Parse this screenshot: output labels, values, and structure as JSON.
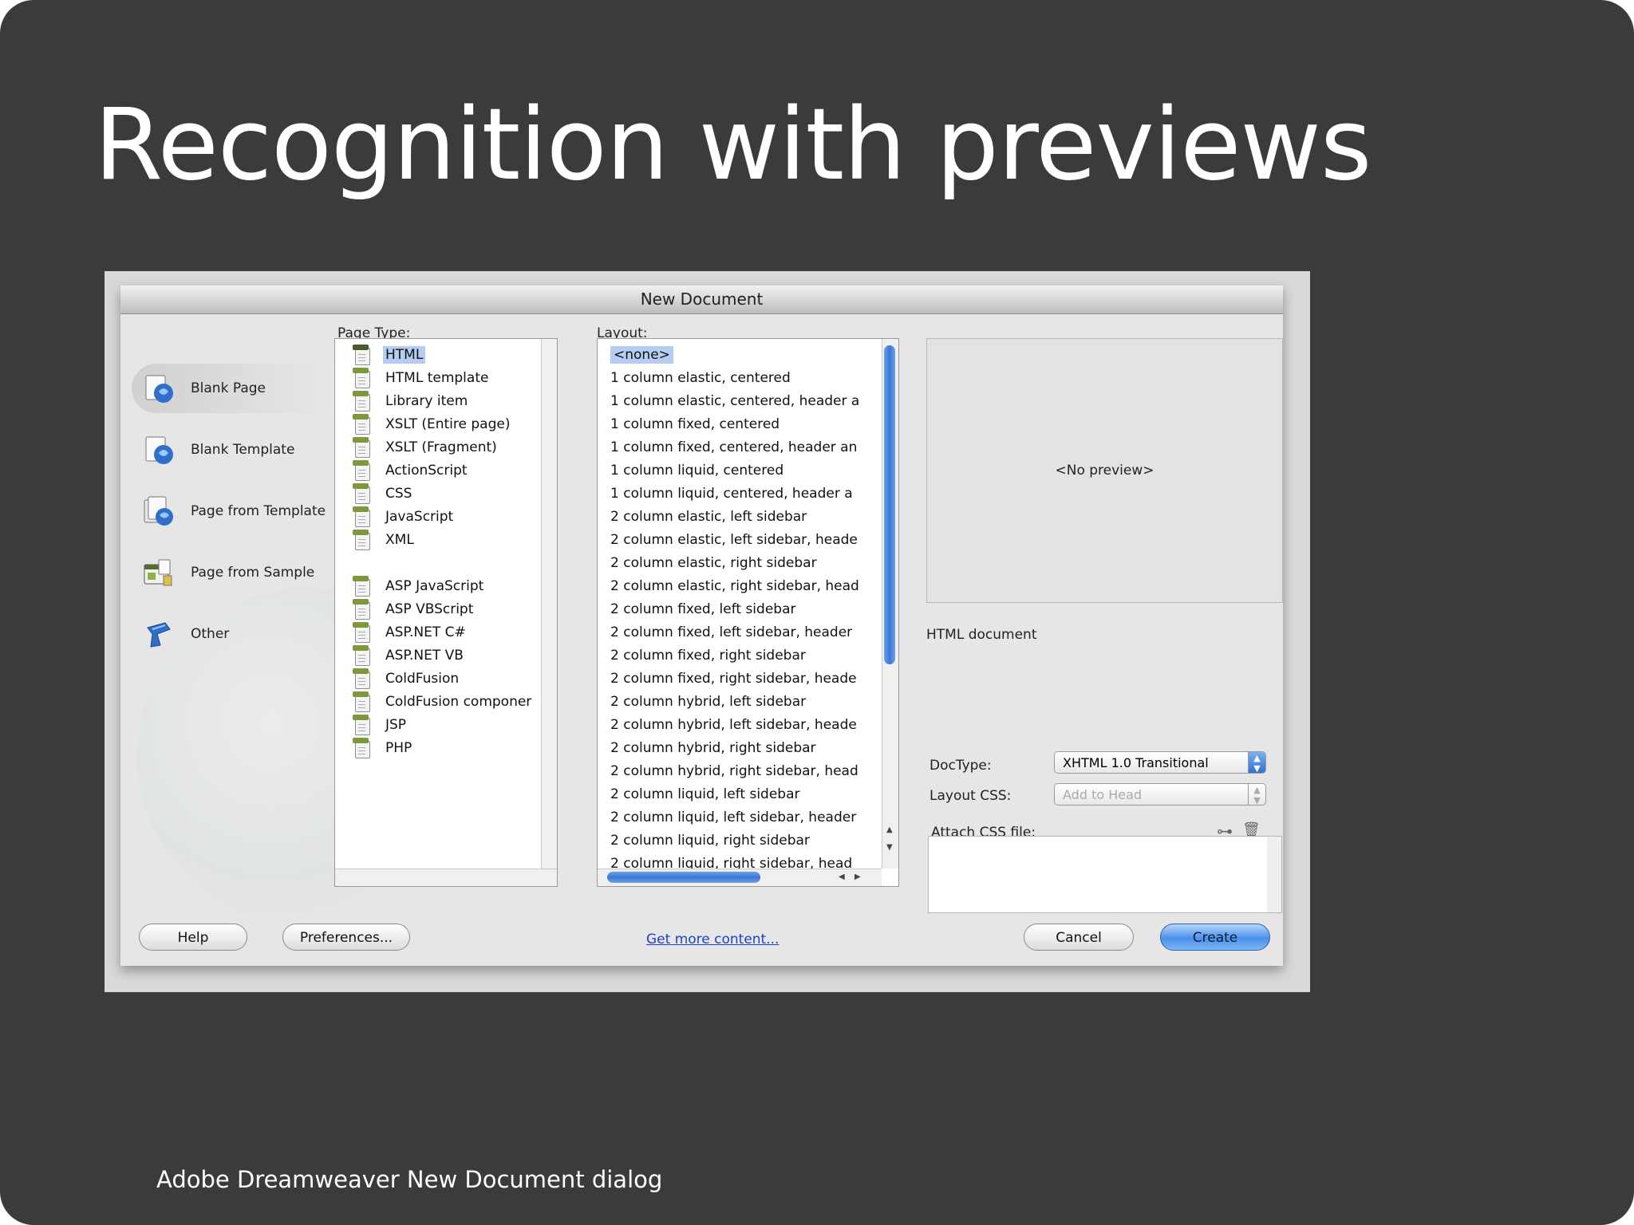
{
  "slide": {
    "title": "Recognition with previews",
    "caption": "Adobe Dreamweaver New Document dialog"
  },
  "dialog": {
    "title": "New Document",
    "categories": [
      {
        "label": "Blank Page",
        "icon": "blank-page-icon",
        "selected": true
      },
      {
        "label": "Blank Template",
        "icon": "blank-template-icon"
      },
      {
        "label": "Page from Template",
        "icon": "page-from-template-icon"
      },
      {
        "label": "Page from Sample",
        "icon": "page-from-sample-icon"
      },
      {
        "label": "Other",
        "icon": "other-icon"
      }
    ],
    "page_type": {
      "label": "Page Type:",
      "items": [
        "HTML",
        "HTML template",
        "Library item",
        "XSLT (Entire page)",
        "XSLT (Fragment)",
        "ActionScript",
        "CSS",
        "JavaScript",
        "XML",
        "ASP JavaScript",
        "ASP VBScript",
        "ASP.NET C#",
        "ASP.NET VB",
        "ColdFusion",
        "ColdFusion componer",
        "JSP",
        "PHP"
      ],
      "selected": "HTML"
    },
    "layout": {
      "label": "Layout:",
      "items": [
        "<none>",
        "1 column elastic, centered",
        "1 column elastic, centered, header a",
        "1 column fixed, centered",
        "1 column fixed, centered, header an",
        "1 column liquid, centered",
        "1 column liquid, centered, header a",
        "2 column elastic, left sidebar",
        "2 column elastic, left sidebar, heade",
        "2 column elastic, right sidebar",
        "2 column elastic, right sidebar, head",
        "2 column fixed, left sidebar",
        "2 column fixed, left sidebar, header",
        "2 column fixed, right sidebar",
        "2 column fixed, right sidebar, heade",
        "2 column hybrid, left sidebar",
        "2 column hybrid, left sidebar, heade",
        "2 column hybrid, right sidebar",
        "2 column hybrid, right sidebar, head",
        "2 column liquid, left sidebar",
        "2 column liquid, left sidebar, header",
        "2 column liquid, right sidebar",
        "2 column liquid, right sidebar, head"
      ],
      "selected": "<none>"
    },
    "preview": {
      "text": "<No preview>",
      "description": "HTML document"
    },
    "doctype": {
      "label": "DocType:",
      "value": "XHTML 1.0 Transitional"
    },
    "layout_css": {
      "label": "Layout CSS:",
      "value": "Add to Head"
    },
    "attach_css": {
      "label": "Attach CSS file:"
    },
    "buttons": {
      "help": "Help",
      "preferences": "Preferences...",
      "get_more": "Get more content...",
      "cancel": "Cancel",
      "create": "Create"
    },
    "colors": {
      "selection": "#b4cdf0",
      "accent": "#3a78d8"
    }
  }
}
